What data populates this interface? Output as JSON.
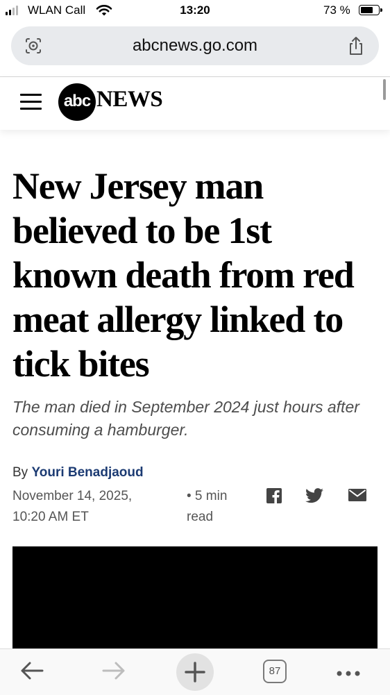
{
  "status_bar": {
    "carrier": "WLAN Call",
    "time": "13:20",
    "battery_percent": "73 %",
    "battery_level": 0.73,
    "signal_bars_total": 4,
    "signal_bars_active": 2,
    "icons": [
      "signal-icon",
      "wifi-icon",
      "battery-icon"
    ]
  },
  "browser": {
    "url": "abcnews.go.com",
    "tab_count": "87",
    "icons": [
      "lens-icon",
      "share-icon",
      "back-arrow-icon",
      "forward-arrow-icon",
      "new-tab-plus-icon",
      "tabs-icon",
      "more-icon"
    ]
  },
  "site": {
    "logo_circle": "abc",
    "logo_word": "NEWS",
    "menu_icon": "hamburger-menu-icon"
  },
  "article": {
    "headline": "New Jersey man believed to be 1st known death from red meat allergy linked to tick bites",
    "subheadline": "The man died in September 2024 just hours after consuming a hamburger.",
    "by_label": "By",
    "author": "Youri Benadjaoud",
    "date": "November 14, 2025, 10:20 AM ET",
    "read_time": "• 5 min read",
    "share_icons": [
      "facebook-icon",
      "twitter-icon",
      "email-icon"
    ]
  },
  "colors": {
    "author_link": "#1c3b73",
    "address_bar": "#e8eaed",
    "subhead_text": "#4d4d4d",
    "meta_text": "#555555"
  }
}
